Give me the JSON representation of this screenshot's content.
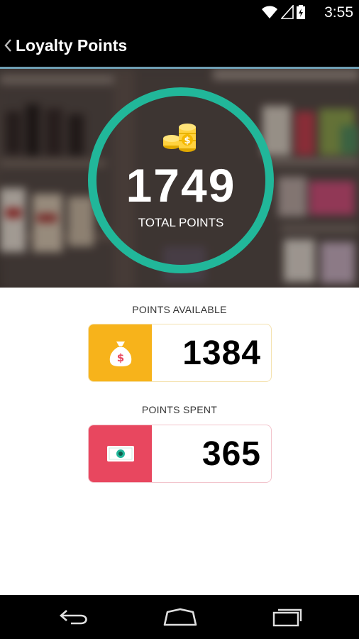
{
  "status_bar": {
    "time": "3:55"
  },
  "app_bar": {
    "title": "Loyalty Points"
  },
  "hero": {
    "total_points": "1749",
    "total_label": "TOTAL POINTS"
  },
  "available": {
    "label": "POINTS AVAILABLE",
    "value": "1384",
    "color": "#f7b31b"
  },
  "spent": {
    "label": "POINTS SPENT",
    "value": "365",
    "color": "#e8475f"
  },
  "colors": {
    "ring": "#21b79a",
    "bars": "#000000"
  }
}
